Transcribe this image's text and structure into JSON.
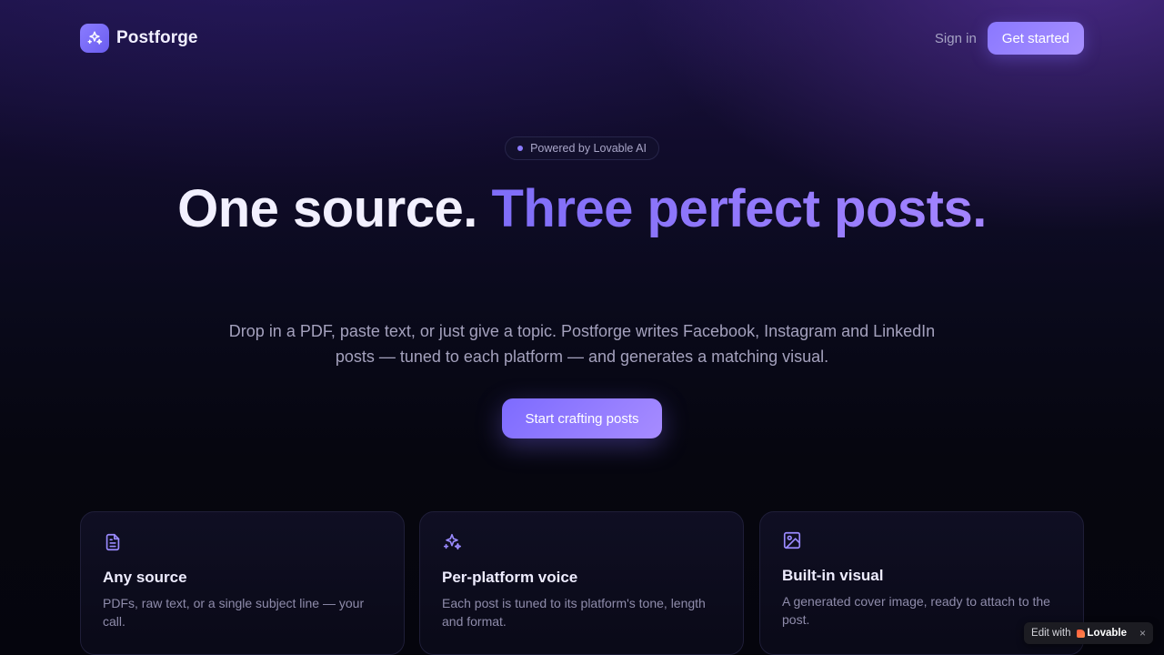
{
  "header": {
    "brand_name": "Postforge",
    "logo_icon": "sparkles-icon",
    "signin_label": "Sign in",
    "get_started_label": "Get started"
  },
  "hero": {
    "badge_text": "Powered by Lovable AI",
    "headline_part1": "One source.",
    "headline_part2": "Three perfect posts.",
    "subtitle": "Drop in a PDF, paste text, or just give a topic. Postforge writes Facebook, Instagram and LinkedIn posts — tuned to each platform — and generates a matching visual.",
    "cta_label": "Start crafting posts"
  },
  "features": [
    {
      "icon": "document-icon",
      "title": "Any source",
      "description": "PDFs, raw text, or a single subject line — your call."
    },
    {
      "icon": "sparkles-icon",
      "title": "Per-platform voice",
      "description": "Each post is tuned to its platform's tone, length and format."
    },
    {
      "icon": "image-icon",
      "title": "Built-in visual",
      "description": "A generated cover image, ready to attach to the post."
    }
  ],
  "edit_badge": {
    "prefix": "Edit with",
    "brand": "Lovable",
    "close": "×"
  },
  "colors": {
    "accent": "#8b7bff",
    "accent_light": "#a384ff",
    "background": "#05050f"
  }
}
